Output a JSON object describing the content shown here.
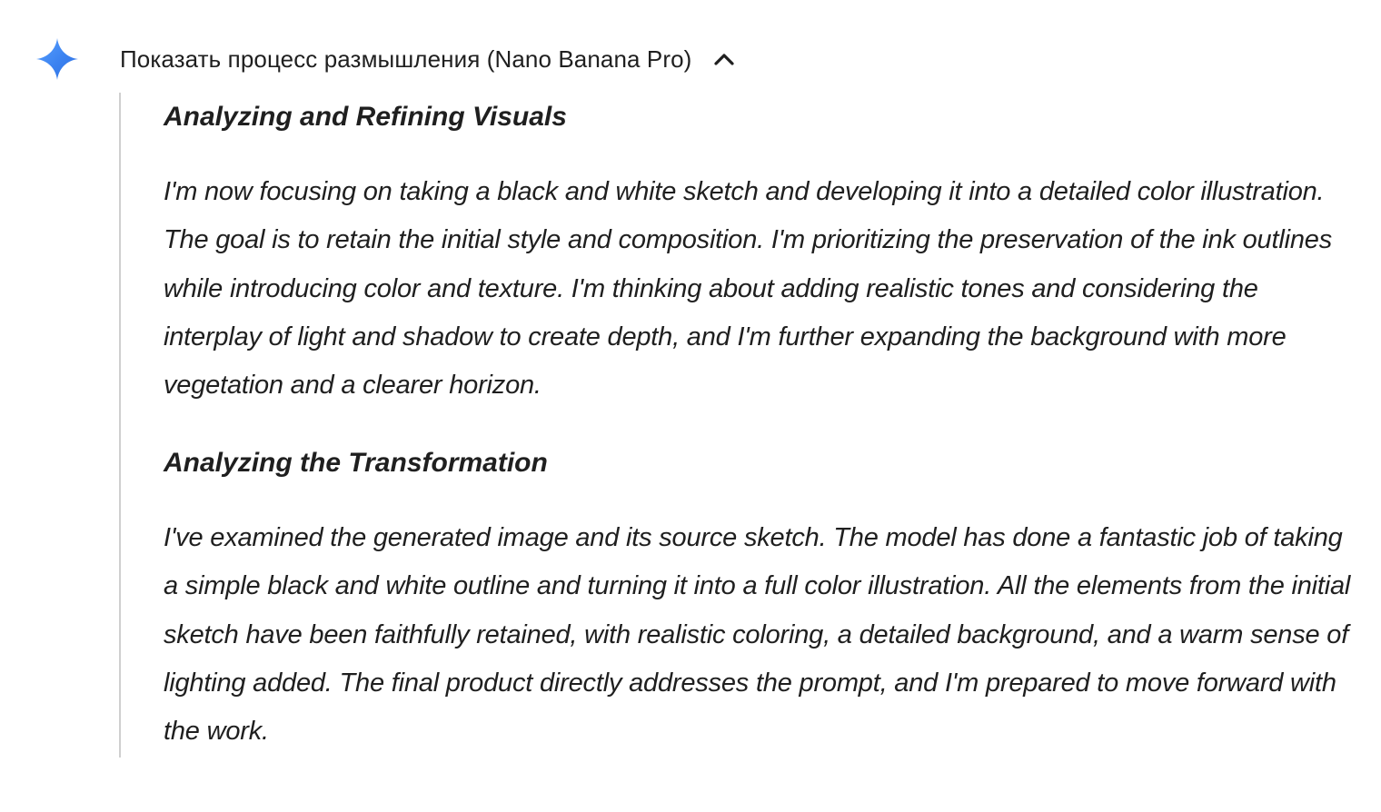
{
  "header": {
    "title": "Показать процесс размышления (Nano Banana Pro)",
    "spark_icon": "gemini-spark-icon",
    "toggle_icon": "chevron-up-icon",
    "accent_color": "#4285f4"
  },
  "thoughts": [
    {
      "title": "Analyzing and Refining Visuals",
      "body": "I'm now focusing on taking a black and white sketch and developing it into a detailed color illustration. The goal is to retain the initial style and composition. I'm prioritizing the preservation of the ink outlines while introducing color and texture. I'm thinking about adding realistic tones and considering the interplay of light and shadow to create depth, and I'm further expanding the background with more vegetation and a clearer horizon."
    },
    {
      "title": "Analyzing the Transformation",
      "body": "I've examined the generated image and its source sketch. The model has done a fantastic job of taking a simple black and white outline and turning it into a full color illustration. All the elements from the initial sketch have been faithfully retained, with realistic coloring, a detailed background, and a warm sense of lighting added. The final product directly addresses the prompt, and I'm prepared to move forward with the work."
    }
  ]
}
